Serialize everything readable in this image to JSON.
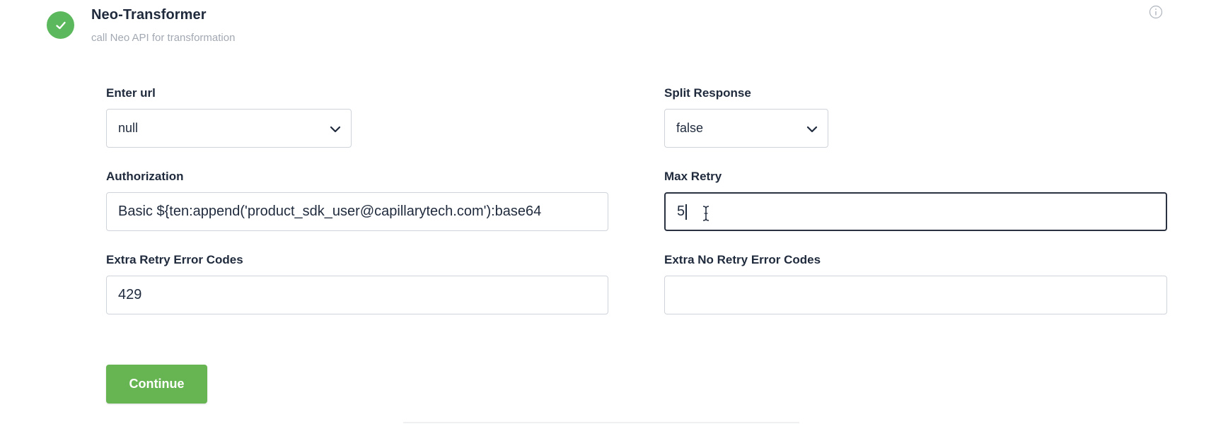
{
  "step": {
    "title": "Neo-Transformer",
    "subtitle": "call Neo API for transformation",
    "status": "completed",
    "status_icon": "check-icon",
    "info_icon": "info-icon"
  },
  "form": {
    "enter_url": {
      "label": "Enter url",
      "value": "null",
      "icon": "chevron-down-icon"
    },
    "split_response": {
      "label": "Split Response",
      "value": "false",
      "icon": "chevron-down-icon"
    },
    "authorization": {
      "label": "Authorization",
      "value": "Basic ${ten:append('product_sdk_user@capillarytech.com'):base64"
    },
    "max_retry": {
      "label": "Max Retry",
      "value": "5"
    },
    "extra_retry_error_codes": {
      "label": "Extra Retry Error Codes",
      "value": "429"
    },
    "extra_no_retry_error_codes": {
      "label": "Extra No Retry Error Codes",
      "value": ""
    }
  },
  "actions": {
    "continue_label": "Continue"
  },
  "colors": {
    "success": "#5cb85c",
    "button": "#67b552",
    "text": "#1f2a3c",
    "muted": "#a3a9b3",
    "border": "#cfd4da"
  }
}
